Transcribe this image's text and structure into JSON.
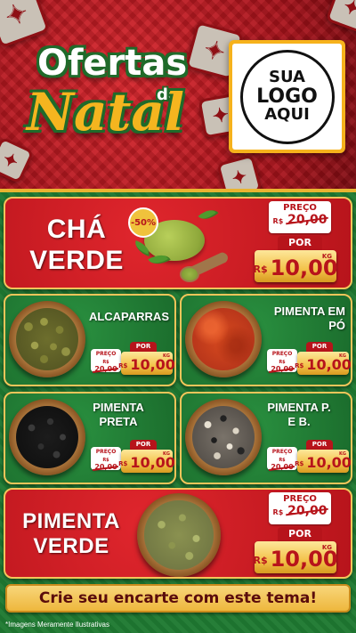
{
  "header": {
    "title_line1": "Ofertas",
    "title_line2": "de",
    "title_line3": "Natal",
    "logo_line1": "SUA",
    "logo_line2": "LOGO",
    "logo_line3": "AQUI"
  },
  "products": [
    {
      "name_line1": "CHÁ",
      "name_line2": "VERDE",
      "badge": "-50%",
      "old_label": "PREÇO",
      "old_price": "20,00",
      "currency": "R$",
      "por_label": "POR",
      "new_price": "10,00",
      "unit": "KG"
    },
    {
      "name_line1": "ALCAPARRAS",
      "name_line2": "",
      "old_label": "PREÇO",
      "old_price": "20,00",
      "currency": "R$",
      "por_label": "POR",
      "new_price": "10,00",
      "unit": "KG"
    },
    {
      "name_line1": "PIMENTA EM",
      "name_line2": "PÓ",
      "old_label": "PREÇO",
      "old_price": "20,00",
      "currency": "R$",
      "por_label": "POR",
      "new_price": "10,00",
      "unit": "KG"
    },
    {
      "name_line1": "PIMENTA",
      "name_line2": "PRETA",
      "old_label": "PREÇO",
      "old_price": "20,00",
      "currency": "R$",
      "por_label": "POR",
      "new_price": "10,00",
      "unit": "KG"
    },
    {
      "name_line1": "PIMENTA P.",
      "name_line2": "E B.",
      "old_label": "PREÇO",
      "old_price": "20,00",
      "currency": "R$",
      "por_label": "POR",
      "new_price": "10,00",
      "unit": "KG"
    },
    {
      "name_line1": "PIMENTA",
      "name_line2": "VERDE",
      "old_label": "PREÇO",
      "old_price": "20,00",
      "currency": "R$",
      "por_label": "POR",
      "new_price": "10,00",
      "unit": "KG"
    }
  ],
  "footer": {
    "cta": "Crie seu encarte com este tema!",
    "disclaimer": "*Imagens Meramente Ilustrativas"
  },
  "colors": {
    "red": "#b7141b",
    "green": "#1f7a32",
    "gold": "#f3c24a"
  }
}
